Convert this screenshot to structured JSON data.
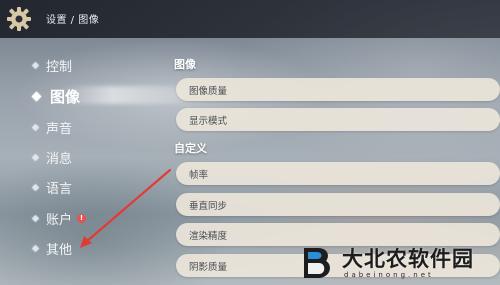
{
  "header": {
    "breadcrumb": "设置 / 图像"
  },
  "sidebar": {
    "items": [
      {
        "label": "控制",
        "active": false
      },
      {
        "label": "图像",
        "active": true
      },
      {
        "label": "声音",
        "active": false
      },
      {
        "label": "消息",
        "active": false
      },
      {
        "label": "语言",
        "active": false
      },
      {
        "label": "账户",
        "active": false,
        "badge": "!"
      },
      {
        "label": "其他",
        "active": false
      }
    ]
  },
  "main": {
    "sections": [
      {
        "title": "图像",
        "rows": [
          "图像质量",
          "显示模式"
        ]
      },
      {
        "title": "自定义",
        "rows": [
          "帧率",
          "垂直同步",
          "渲染精度",
          "阴影质量"
        ]
      }
    ]
  },
  "watermark": {
    "text": "大北农软件园",
    "subtext": "dabeinong.net"
  },
  "colors": {
    "row_bg": "#ece5da",
    "row_text": "#4a4d52",
    "badge": "#e6534f",
    "arrow": "#e23b36",
    "topbar": "#1c2028"
  }
}
